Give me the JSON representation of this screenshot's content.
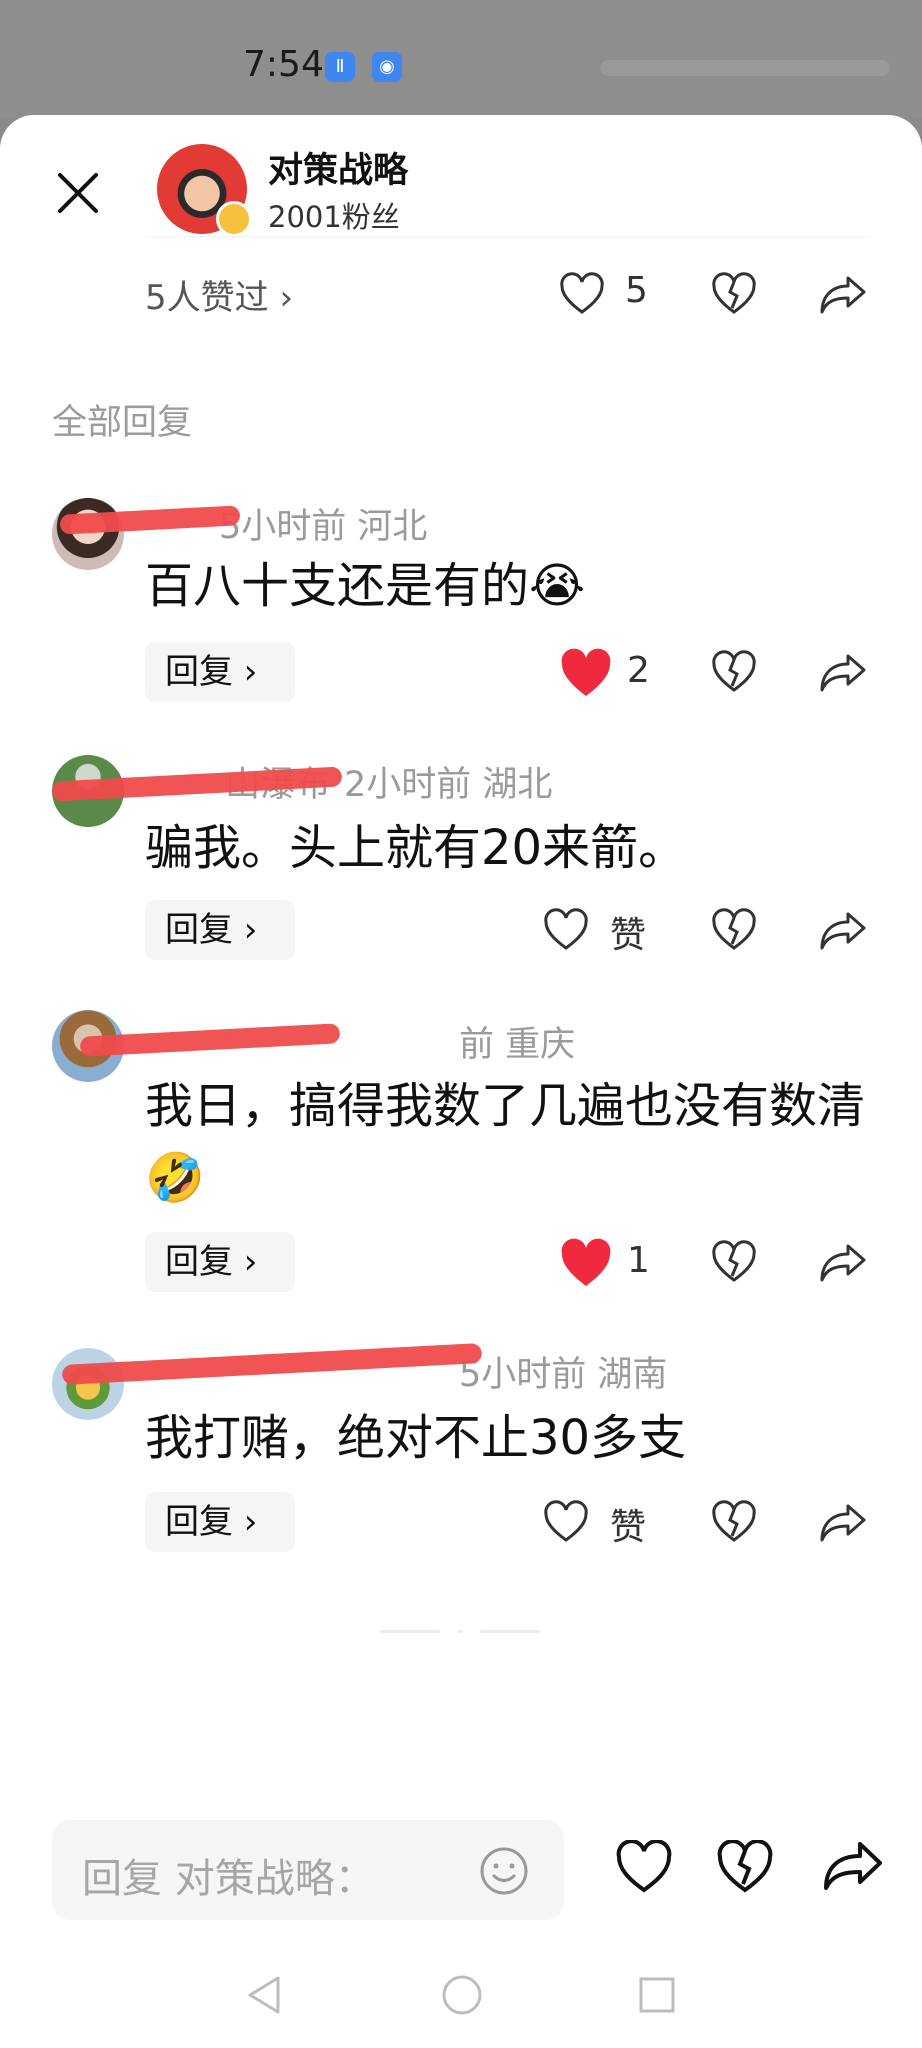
{
  "status_bar": {
    "time": "7:54",
    "icons": [
      "app-icon-1",
      "app-icon-2"
    ]
  },
  "header": {
    "author_name": "对策战略",
    "author_fans": "2001粉丝",
    "icons": {
      "close": "close-icon",
      "avatar_badge": "verified-badge-icon"
    }
  },
  "post_actions": {
    "liked_by": "5人赞过",
    "like_count": "5",
    "icons": [
      "heart-outline-icon",
      "broken-heart-icon",
      "share-icon"
    ]
  },
  "section_title": "全部回复",
  "comments": [
    {
      "name": "",
      "time_location": "5小时前  河北",
      "text": "百八十支还是有的",
      "emoji": "😭",
      "reply_label": "回复",
      "like_label": "2",
      "liked": true
    },
    {
      "name": "山瀑布",
      "time_location": "2小时前  湖北",
      "text": "骗我。头上就有20来箭。",
      "emoji": "",
      "reply_label": "回复",
      "like_label": "赞",
      "liked": false
    },
    {
      "name": "",
      "time_location": "前  重庆",
      "text": "我日，搞得我数了几遍也没有数清",
      "emoji": "🤣",
      "reply_label": "回复",
      "like_label": "1",
      "liked": true
    },
    {
      "name": "",
      "time_location": "5小时前  湖南",
      "text": "我打赌，绝对不止30多支",
      "emoji": "",
      "reply_label": "回复",
      "like_label": "赞",
      "liked": false
    }
  ],
  "reply_input": {
    "placeholder": "回复 对策战略："
  },
  "colors": {
    "liked_red": "#ee2a3c",
    "redaction": "#ef4b4b",
    "muted": "#9a9a9a"
  },
  "nav_icons": [
    "back-triangle-icon",
    "home-circle-icon",
    "recent-square-icon"
  ]
}
